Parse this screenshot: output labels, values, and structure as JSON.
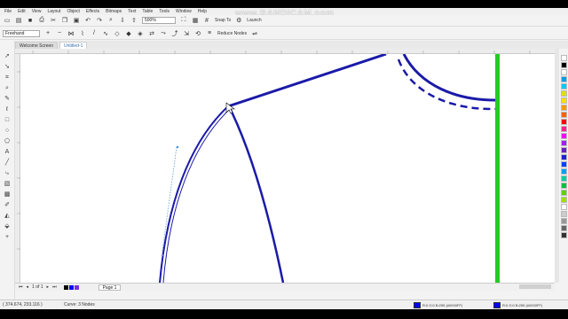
{
  "menu": [
    "File",
    "Edit",
    "View",
    "Layout",
    "Object",
    "Effects",
    "Bitmaps",
    "Text",
    "Table",
    "Tools",
    "Window",
    "Help"
  ],
  "watermark": "www.BANDICAM.com",
  "toolbar": {
    "zoom_value": "500%",
    "snap_label": "Snap To",
    "launch_label": "Launch"
  },
  "property_bar": {
    "tool_mode": "Freehand",
    "reduce_nodes_label": "Reduce Nodes"
  },
  "tabs": [
    {
      "label": "Welcome Screen",
      "active": false
    },
    {
      "label": "Untitled-1",
      "active": true
    }
  ],
  "page_nav": {
    "page_label": "Page 1",
    "counter": "1 of 1"
  },
  "status": {
    "coords": "( 374.674, 233.116 )",
    "info": "Curve: 3 Nodes",
    "fill_text": "R:0 G:0 B:255 (#0000FF)",
    "outline_text": "R:0 G:0 B:255 (#0000FF)"
  },
  "colors": {
    "curve": "#1a1aa8",
    "guide": "#22cc22",
    "fill": "#0000ff"
  },
  "palette": [
    "#ffffff",
    "#000000",
    "#ffffff",
    "#00a0e8",
    "#00c8ff",
    "#e0e000",
    "#ffe000",
    "#ff9a00",
    "#ff6000",
    "#ff0000",
    "#ff2090",
    "#ff00ff",
    "#a020f0",
    "#6a20c0",
    "#2020d0",
    "#0040ff",
    "#00a0ff",
    "#00d0a0",
    "#00c040",
    "#60d000",
    "#a0e000",
    "#ffffff",
    "#cccccc",
    "#999999",
    "#666666",
    "#333333"
  ],
  "icons": [
    "new-icon",
    "open-icon",
    "save-icon",
    "print-icon",
    "cut-icon",
    "copy-icon",
    "paste-icon",
    "undo-icon",
    "redo-icon",
    "search-icon",
    "import-icon",
    "export-icon"
  ]
}
